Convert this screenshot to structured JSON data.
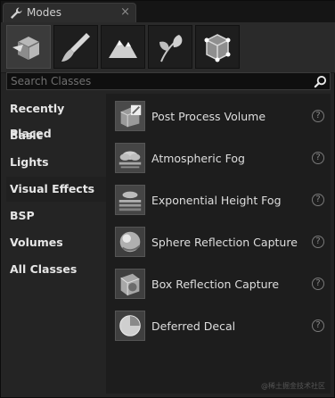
{
  "window": {
    "tab_title": "Modes",
    "tab_icon": "wrench-icon",
    "close_label": "×"
  },
  "toolbar": {
    "modes": [
      {
        "name": "place-mode",
        "icon": "cube-place-icon",
        "active": true
      },
      {
        "name": "paint-mode",
        "icon": "brush-icon",
        "active": false
      },
      {
        "name": "landscape-mode",
        "icon": "mountain-icon",
        "active": false
      },
      {
        "name": "foliage-mode",
        "icon": "leaf-icon",
        "active": false
      },
      {
        "name": "geometry-mode",
        "icon": "geometry-cube-icon",
        "active": false
      }
    ]
  },
  "search": {
    "placeholder": "Search Classes"
  },
  "sidebar": {
    "categories": [
      {
        "label": "Recently Placed"
      },
      {
        "label": "Basic"
      },
      {
        "label": "Lights"
      },
      {
        "label": "Visual Effects",
        "selected": true
      },
      {
        "label": "BSP"
      },
      {
        "label": "Volumes"
      },
      {
        "label": "All Classes"
      }
    ]
  },
  "items": [
    {
      "label": "Post Process Volume",
      "icon": "post-process-volume-icon",
      "help": "?"
    },
    {
      "label": "Atmospheric Fog",
      "icon": "atmospheric-fog-icon",
      "help": "?"
    },
    {
      "label": "Exponential Height Fog",
      "icon": "exponential-height-fog-icon",
      "help": "?"
    },
    {
      "label": "Sphere Reflection Capture",
      "icon": "sphere-reflection-icon",
      "help": "?"
    },
    {
      "label": "Box Reflection Capture",
      "icon": "box-reflection-icon",
      "help": "?"
    },
    {
      "label": "Deferred Decal",
      "icon": "deferred-decal-icon",
      "help": "?"
    }
  ],
  "watermark": "@稀土掘金技术社区"
}
